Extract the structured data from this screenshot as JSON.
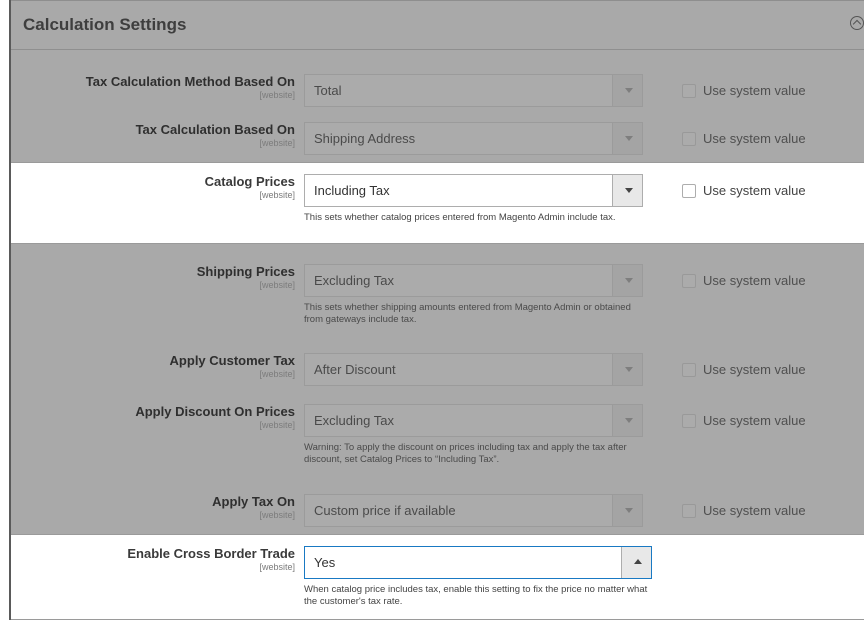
{
  "header": {
    "title": "Calculation Settings"
  },
  "scope_label": "[website]",
  "use_system_value": "Use system value",
  "rows": [
    {
      "label": "Tax Calculation Method Based On",
      "value": "Total"
    },
    {
      "label": "Tax Calculation Based On",
      "value": "Shipping Address"
    },
    {
      "label": "Catalog Prices",
      "value": "Including Tax",
      "note": "This sets whether catalog prices entered from Magento Admin include tax."
    },
    {
      "label": "Shipping Prices",
      "value": "Excluding Tax",
      "note": "This sets whether shipping amounts entered from Magento Admin or obtained from gateways include tax."
    },
    {
      "label": "Apply Customer Tax",
      "value": "After Discount"
    },
    {
      "label": "Apply Discount On Prices",
      "value": "Excluding Tax",
      "note": "Warning: To apply the discount on prices including tax and apply the tax after discount, set Catalog Prices to “Including Tax”."
    },
    {
      "label": "Apply Tax On",
      "value": "Custom price if available"
    },
    {
      "label": "Enable Cross Border Trade",
      "value": "Yes",
      "note": "When catalog price includes tax, enable this setting to fix the price no matter what the customer's tax rate."
    }
  ]
}
